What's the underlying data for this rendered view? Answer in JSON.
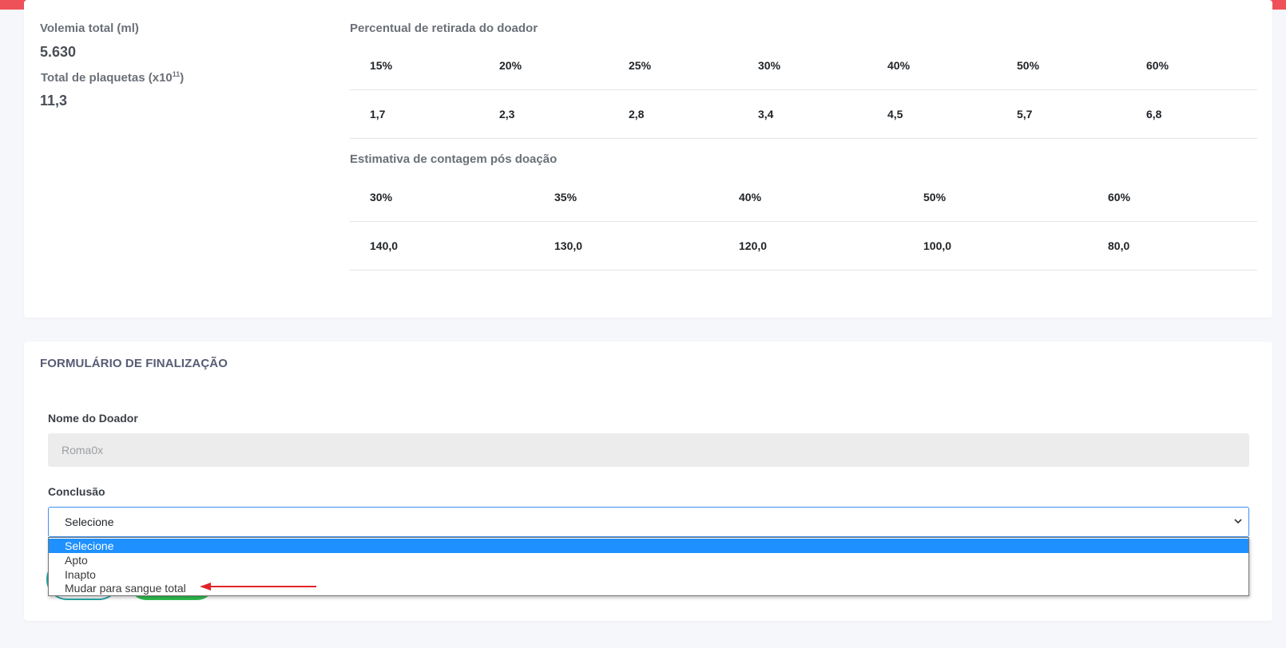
{
  "summary": {
    "volemia_label": "Volemia total (ml)",
    "volemia_value": "5.630",
    "plaquetas_label": "Total de plaquetas (x10",
    "plaquetas_sup": "11",
    "plaquetas_label_end": ")",
    "plaquetas_value": "11,3"
  },
  "percentual": {
    "title": "Percentual de retirada do doador",
    "headers": [
      "15%",
      "20%",
      "25%",
      "30%",
      "40%",
      "50%",
      "60%"
    ],
    "values": [
      "1,7",
      "2,3",
      "2,8",
      "3,4",
      "4,5",
      "5,7",
      "6,8"
    ]
  },
  "estimativa": {
    "title": "Estimativa de contagem pós doação",
    "headers": [
      "30%",
      "35%",
      "40%",
      "50%",
      "60%"
    ],
    "values": [
      "140,0",
      "130,0",
      "120,0",
      "100,0",
      "80,0"
    ]
  },
  "form": {
    "title": "FORMULÁRIO DE FINALIZAÇÃO",
    "donor_label": "Nome do Doador",
    "donor_value": "Roma0x",
    "conclusion_label": "Conclusão",
    "conclusion_selected": "Selecione",
    "options": [
      "Selecione",
      "Apto",
      "Inapto",
      "Mudar para sangue total"
    ]
  },
  "colors": {
    "topbar": "#ef5159",
    "select_highlight": "#1e90ff",
    "annotation_arrow": "#e0242b"
  }
}
